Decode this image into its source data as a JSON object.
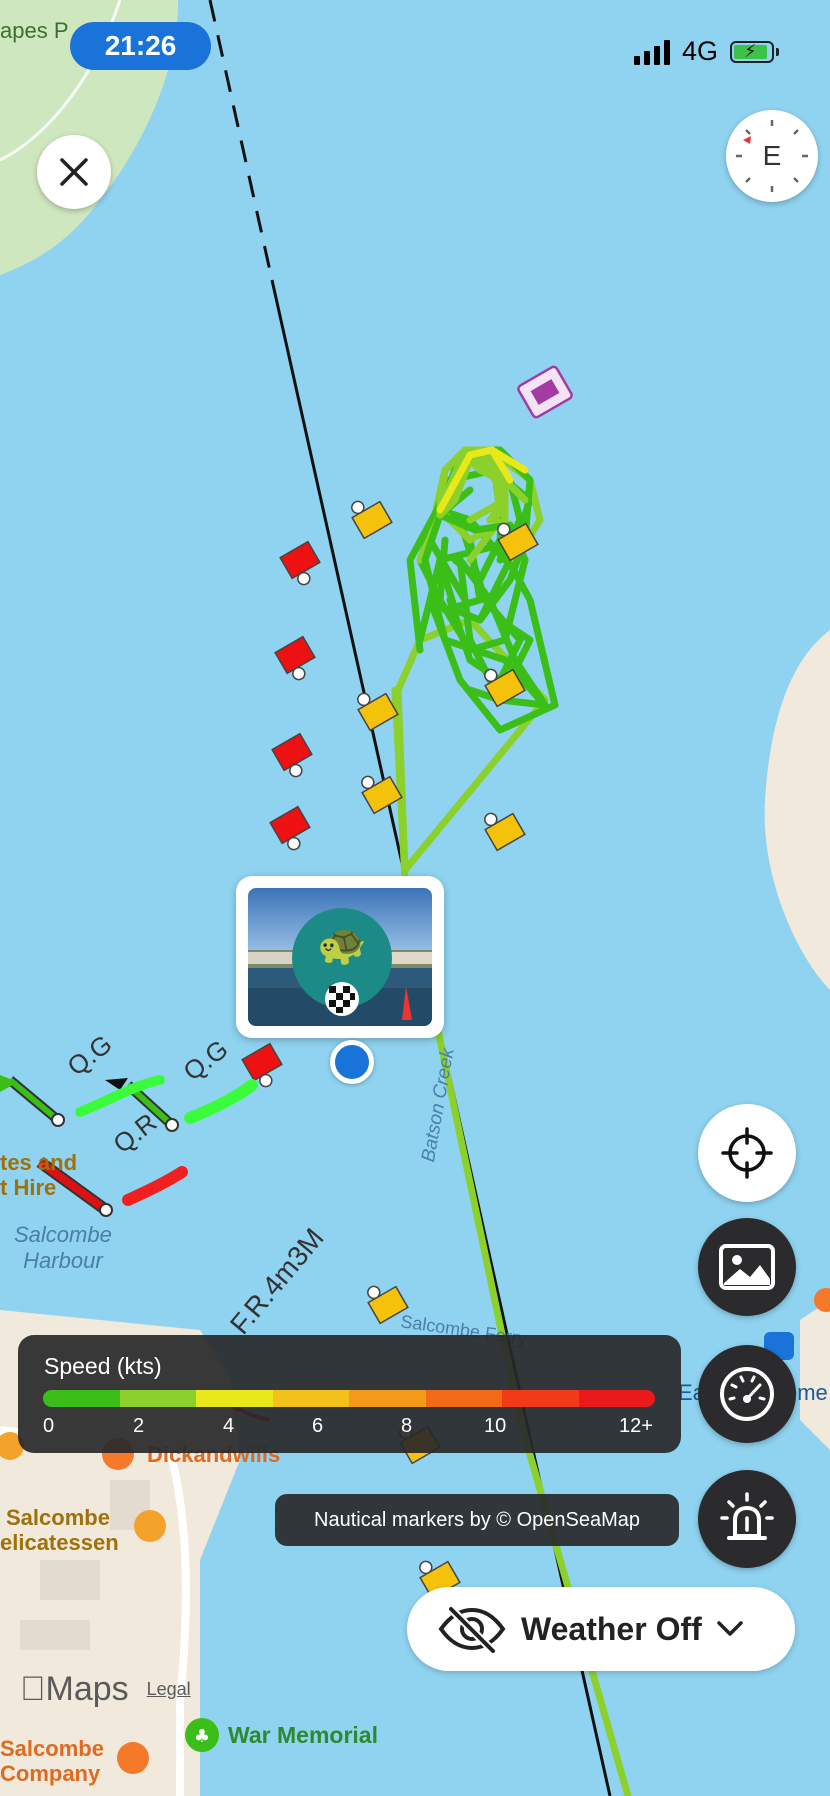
{
  "status_bar": {
    "time": "21:26",
    "network": "4G"
  },
  "compass": {
    "heading_letter": "E"
  },
  "map_labels": {
    "top_left_partial": "apes P",
    "salcombe_harbour": [
      "Salcombe",
      "Harbour"
    ],
    "batson_creek": "Batson Creek",
    "boat_hire_partial": [
      "tes and",
      "t Hire"
    ],
    "salcombe_ferry_partial": "Salcombe Ferry",
    "dickandwills": "Dickandwills",
    "salcombe_delicatessen": [
      "Salcombe",
      "elicatessen"
    ],
    "salcombe_company": [
      "Salcombe",
      "Company"
    ],
    "war_memorial": "War Memorial",
    "east_partial": "Ea",
    "memorial_partial": "eme",
    "qg_1": "Q.G",
    "qg_2": "Q.G",
    "qr": "Q.R",
    "fr_light": "F.R.4m3M"
  },
  "speed_legend": {
    "title": "Speed (kts)",
    "ticks": [
      "0",
      "2",
      "4",
      "6",
      "8",
      "10",
      "12+"
    ],
    "colors": [
      "#3bbf18",
      "#8cd12b",
      "#e9e81a",
      "#f4c01a",
      "#f39a18",
      "#f26a18",
      "#f03a18",
      "#ea1a1a"
    ]
  },
  "attribution": "Nautical markers by © OpenSeaMap",
  "weather": {
    "label": "Weather Off"
  },
  "apple_maps": {
    "brand": "Maps",
    "legal": "Legal"
  },
  "icons": {
    "close": "close-icon",
    "locate": "crosshair-icon",
    "photo": "photo-icon",
    "speed": "speedometer-icon",
    "alert": "alarm-light-icon",
    "weather": "eye-slash-icon"
  },
  "colors": {
    "water": "#8fd3f0",
    "land": "#f0e9dc",
    "park": "#cfe7bf",
    "track_green": "#3bbf18",
    "track_lime": "#8cd12b",
    "track_yellow": "#e9e81a",
    "position_dot": "#1a73d9"
  }
}
